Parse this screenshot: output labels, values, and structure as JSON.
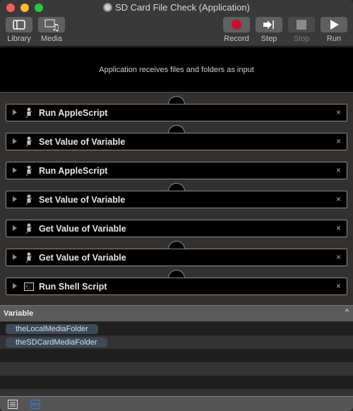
{
  "window": {
    "title": "SD Card File Check (Application)"
  },
  "toolbar": {
    "library_label": "Library",
    "media_label": "Media",
    "record_label": "Record",
    "step_label": "Step",
    "stop_label": "Stop",
    "run_label": "Run"
  },
  "workflow": {
    "input_text": "Application receives files and folders as input",
    "actions": [
      {
        "name": "Run AppleScript",
        "icon": "automator-robot-icon"
      },
      {
        "name": "Set Value of Variable",
        "icon": "automator-robot-icon"
      },
      {
        "name": "Run AppleScript",
        "icon": "automator-robot-icon"
      },
      {
        "name": "Set Value of Variable",
        "icon": "automator-robot-icon"
      },
      {
        "name": "Get Value of Variable",
        "icon": "automator-robot-icon"
      },
      {
        "name": "Get Value of Variable",
        "icon": "automator-robot-icon"
      },
      {
        "name": "Run Shell Script",
        "icon": "terminal-icon"
      }
    ],
    "close_glyph": "×"
  },
  "variables": {
    "header": "Variable",
    "items": [
      "theLocalMediaFolder",
      "theSDCardMediaFolder"
    ]
  },
  "colors": {
    "record": "#c8102e",
    "accent": "#2f7fe0"
  }
}
